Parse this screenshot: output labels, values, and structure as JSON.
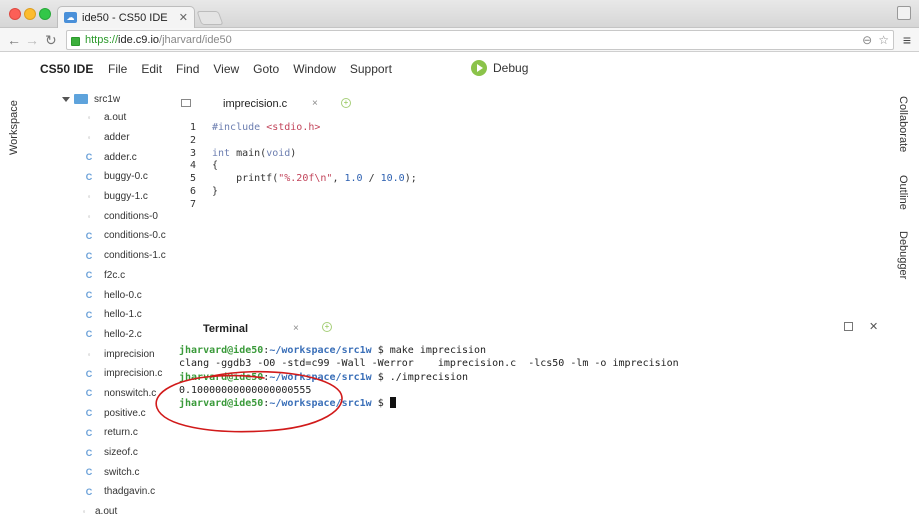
{
  "browser": {
    "tab_title": "ide50 - CS50 IDE",
    "url_scheme": "https://",
    "url_host": "ide.c9.io",
    "url_path": "/jharvard/ide50"
  },
  "ide": {
    "brand": "CS50 IDE",
    "menu": [
      "File",
      "Edit",
      "Find",
      "View",
      "Goto",
      "Window",
      "Support"
    ],
    "debug_label": "Debug",
    "left_panel": "Workspace",
    "right_panels": [
      "Collaborate",
      "Outline",
      "Debugger"
    ]
  },
  "file_tree": {
    "root": "src1w",
    "files": [
      {
        "name": "a.out",
        "type": "bin"
      },
      {
        "name": "adder",
        "type": "bin"
      },
      {
        "name": "adder.c",
        "type": "c"
      },
      {
        "name": "buggy-0.c",
        "type": "c"
      },
      {
        "name": "buggy-1.c",
        "type": "bin"
      },
      {
        "name": "conditions-0",
        "type": "bin"
      },
      {
        "name": "conditions-0.c",
        "type": "c"
      },
      {
        "name": "conditions-1.c",
        "type": "c"
      },
      {
        "name": "f2c.c",
        "type": "c"
      },
      {
        "name": "hello-0.c",
        "type": "c"
      },
      {
        "name": "hello-1.c",
        "type": "c"
      },
      {
        "name": "hello-2.c",
        "type": "c"
      },
      {
        "name": "imprecision",
        "type": "bin"
      },
      {
        "name": "imprecision.c",
        "type": "c"
      },
      {
        "name": "nonswitch.c",
        "type": "c"
      },
      {
        "name": "positive.c",
        "type": "c"
      },
      {
        "name": "return.c",
        "type": "c"
      },
      {
        "name": "sizeof.c",
        "type": "c"
      },
      {
        "name": "switch.c",
        "type": "c"
      },
      {
        "name": "thadgavin.c",
        "type": "c"
      }
    ],
    "bottom_item": "a.out"
  },
  "editor": {
    "tab_label": "imprecision.c",
    "close_glyph": "×",
    "line_numbers": [
      "1",
      "2",
      "3",
      "4",
      "5",
      "6",
      "7"
    ],
    "code": {
      "l1_directive": "#include",
      "l1_header": "<stdio.h>",
      "l3_type": "int",
      "l3_rest": " main(",
      "l3_void": "void",
      "l3_close": ")",
      "l4": "{",
      "l5_indent": "    printf(",
      "l5_str_open": "\"",
      "l5_fmt": "%.20f\\n",
      "l5_str_close": "\"",
      "l5_mid": ", ",
      "l5_num1": "1.0",
      "l5_div": " / ",
      "l5_num2": "10.0",
      "l5_end": ");",
      "l6": "}"
    }
  },
  "terminal": {
    "tab_label": "Terminal",
    "close_glyph": "×",
    "user_host": "jharvard@ide50",
    "colon": ":",
    "path": "~/workspace/src1w",
    "prompt_end": " $ ",
    "cmd1": "make imprecision",
    "output1": "clang -ggdb3 -O0 -std=c99 -Wall -Werror    imprecision.c  -lcs50 -lm -o imprecision",
    "cmd2": "./imprecision",
    "output2": "0.10000000000000000555"
  },
  "colors": {
    "annotation_circle": "#d11a1a",
    "debug_green": "#8bc34a",
    "terminal_user": "#3a9a3a",
    "terminal_path": "#3a6fb8"
  }
}
